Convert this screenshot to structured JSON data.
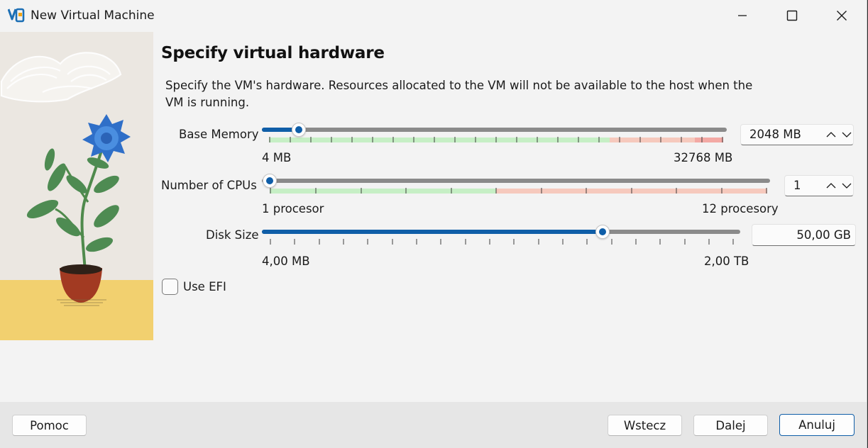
{
  "window": {
    "title": "New Virtual Machine"
  },
  "page": {
    "heading": "Specify virtual hardware",
    "description": "Specify the VM's hardware. Resources allocated to the VM will not be available to the host when the VM is running."
  },
  "memory": {
    "label": "Base Memory",
    "min_label": "4 MB",
    "max_label": "32768 MB",
    "value": "2048 MB",
    "value_mb": 2048,
    "min_mb": 4,
    "max_mb": 32768
  },
  "cpus": {
    "label": "Number of CPUs",
    "min_label": "1 procesor",
    "max_label": "12 procesory",
    "value": "1",
    "min": 1,
    "max": 12
  },
  "disk": {
    "label": "Disk Size",
    "min_label": "4,00 MB",
    "max_label": "2,00 TB",
    "value": "50,00 GB"
  },
  "efi": {
    "label": "Use EFI",
    "checked": false
  },
  "footer": {
    "help": "Pomoc",
    "back": "Wstecz",
    "next": "Dalej",
    "cancel": "Anuluj"
  },
  "colors": {
    "accent": "#0f5ea8",
    "ok_band": "#c6efc5",
    "warn_band": "#f6c9bd",
    "danger_band": "#f3a9a4"
  }
}
